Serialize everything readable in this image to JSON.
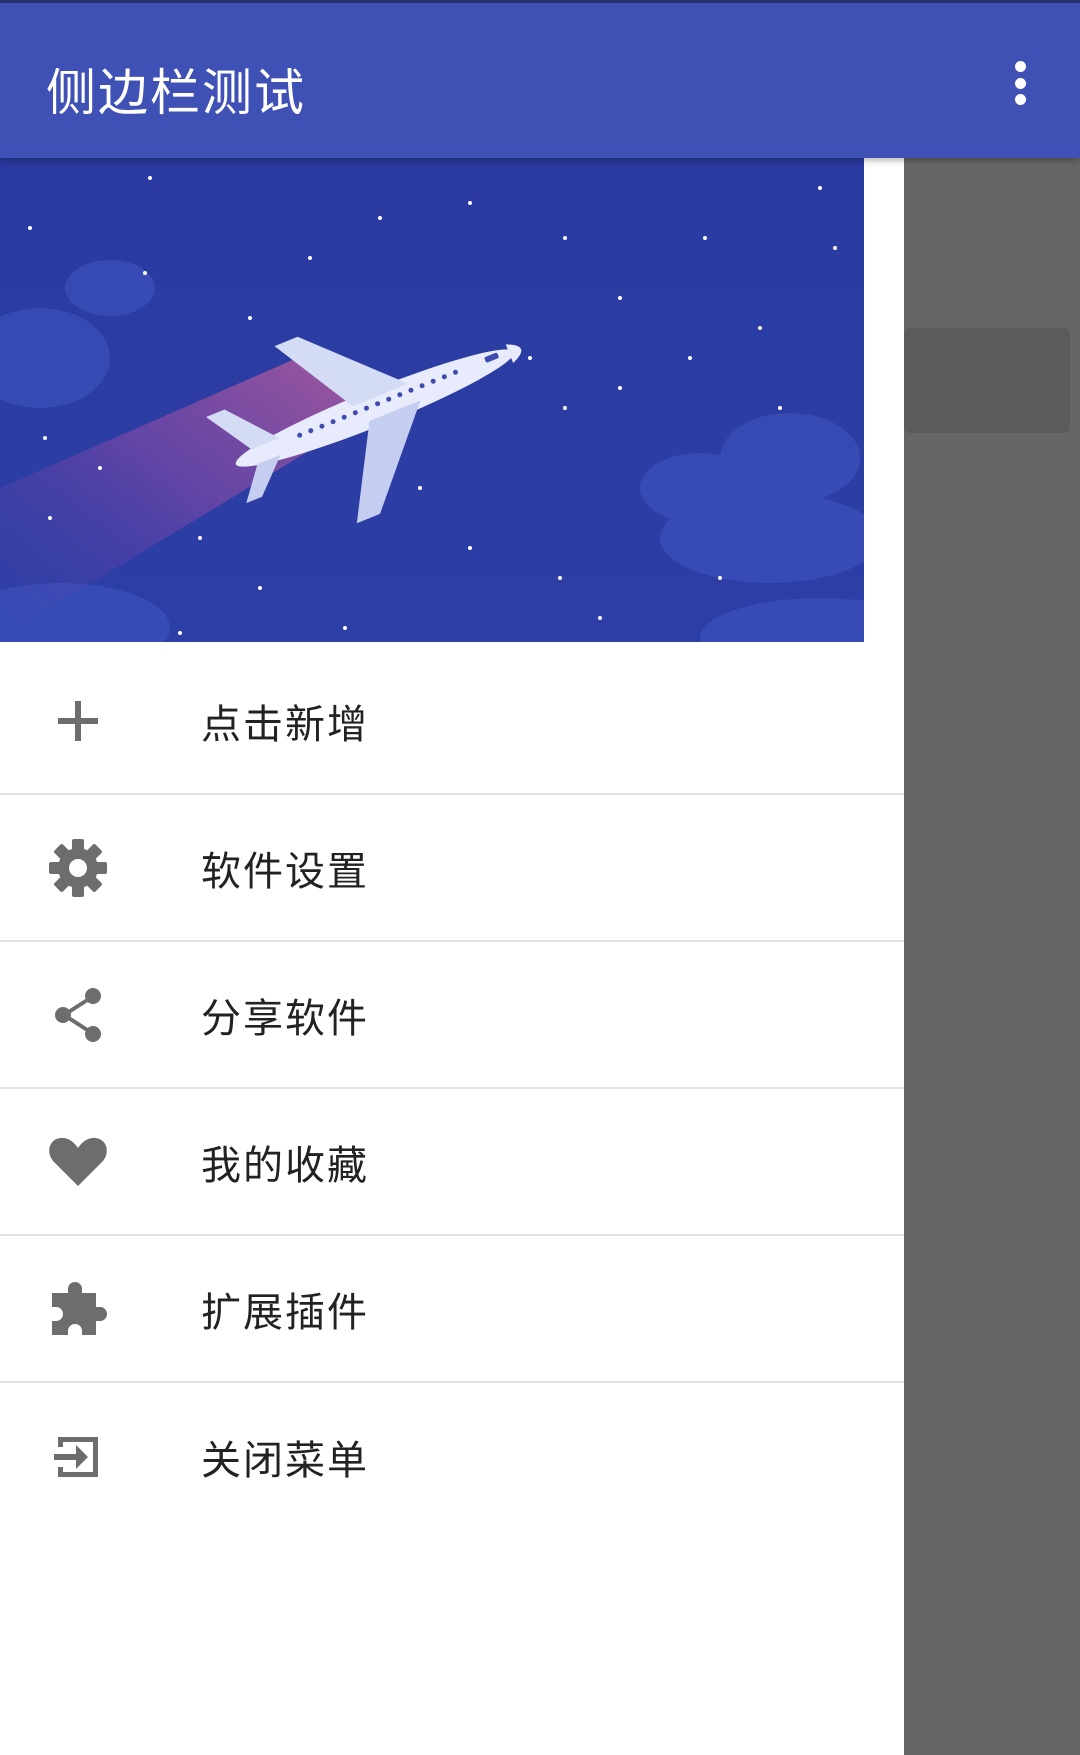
{
  "appbar": {
    "title": "侧边栏测试",
    "overflow_icon": "more-vert-icon",
    "color": "#3f51b5"
  },
  "drawer": {
    "header_image": "night-sky-airplane-illustration",
    "items": [
      {
        "label": "点击新增",
        "icon": "plus-icon"
      },
      {
        "label": "软件设置",
        "icon": "gear-icon"
      },
      {
        "label": "分享软件",
        "icon": "share-icon"
      },
      {
        "label": "我的收藏",
        "icon": "heart-icon"
      },
      {
        "label": "扩展插件",
        "icon": "puzzle-icon"
      },
      {
        "label": "关闭菜单",
        "icon": "exit-icon"
      }
    ]
  }
}
